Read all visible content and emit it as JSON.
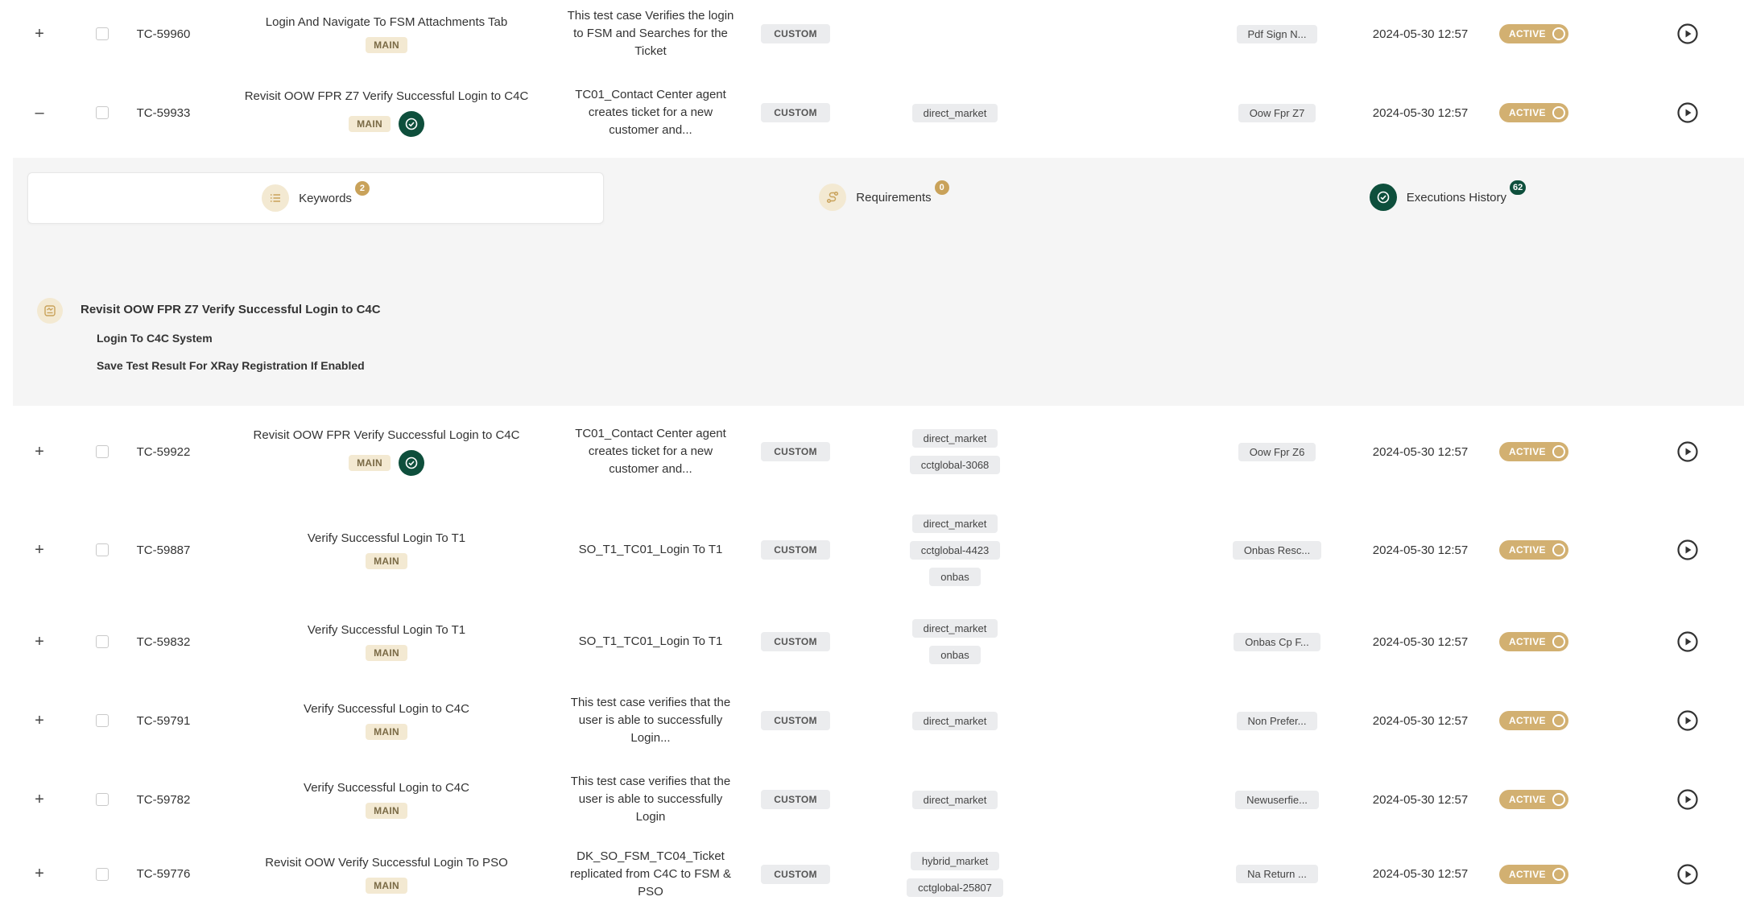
{
  "rows_top": [
    {
      "id": "TC-59960",
      "expander": "+",
      "name": "Login And Navigate To FSM Attachments Tab",
      "branch": "MAIN",
      "verified": false,
      "description": "This test case Verifies the login to FSM and Searches for the Ticket",
      "type": "CUSTOM",
      "tags": [],
      "folder": "Pdf Sign N...",
      "date": "2024-05-30 12:57",
      "status": "ACTIVE"
    },
    {
      "id": "TC-59933",
      "expander": "–",
      "name": "Revisit OOW FPR Z7 Verify Successful Login to C4C",
      "branch": "MAIN",
      "verified": true,
      "description": "TC01_Contact Center agent creates ticket for a new customer and...",
      "type": "CUSTOM",
      "tags": [
        "direct_market"
      ],
      "folder": "Oow Fpr Z7",
      "date": "2024-05-30 12:57",
      "status": "ACTIVE"
    }
  ],
  "detail": {
    "tabs": [
      {
        "label": "Keywords",
        "count": "2",
        "icon": "list-icon"
      },
      {
        "label": "Requirements",
        "count": "0",
        "icon": "route-icon"
      },
      {
        "label": "Executions History",
        "count": "62",
        "icon": "check-circle-icon"
      }
    ],
    "keyword_title": "Revisit OOW FPR Z7 Verify Successful Login to C4C",
    "keyword_steps": [
      "Login To C4C System",
      "Save Test Result For XRay Registration If Enabled"
    ]
  },
  "rows_bottom": [
    {
      "id": "TC-59922",
      "expander": "+",
      "name": "Revisit OOW FPR Verify Successful Login to C4C",
      "branch": "MAIN",
      "verified": true,
      "description": "TC01_Contact Center agent creates ticket for a new customer and...",
      "type": "CUSTOM",
      "tags": [
        "direct_market",
        "cctglobal-3068"
      ],
      "folder": "Oow Fpr Z6",
      "date": "2024-05-30 12:57",
      "status": "ACTIVE"
    },
    {
      "id": "TC-59887",
      "expander": "+",
      "name": "Verify Successful Login To T1",
      "branch": "MAIN",
      "verified": false,
      "description": "SO_T1_TC01_Login To T1",
      "type": "CUSTOM",
      "tags": [
        "direct_market",
        "cctglobal-4423",
        "onbas"
      ],
      "folder": "Onbas Resc...",
      "date": "2024-05-30 12:57",
      "status": "ACTIVE"
    },
    {
      "id": "TC-59832",
      "expander": "+",
      "name": "Verify Successful Login To T1",
      "branch": "MAIN",
      "verified": false,
      "description": "SO_T1_TC01_Login To T1",
      "type": "CUSTOM",
      "tags": [
        "direct_market",
        "onbas"
      ],
      "folder": "Onbas Cp F...",
      "date": "2024-05-30 12:57",
      "status": "ACTIVE"
    },
    {
      "id": "TC-59791",
      "expander": "+",
      "name": "Verify Successful Login to C4C",
      "branch": "MAIN",
      "verified": false,
      "description": "This test case verifies that the user is able to successfully Login...",
      "type": "CUSTOM",
      "tags": [
        "direct_market"
      ],
      "folder": "Non Prefer...",
      "date": "2024-05-30 12:57",
      "status": "ACTIVE"
    },
    {
      "id": "TC-59782",
      "expander": "+",
      "name": "Verify Successful Login to C4C",
      "branch": "MAIN",
      "verified": false,
      "description": "This test case verifies that the user is able to successfully Login",
      "type": "CUSTOM",
      "tags": [
        "direct_market"
      ],
      "folder": "Newuserfie...",
      "date": "2024-05-30 12:57",
      "status": "ACTIVE"
    },
    {
      "id": "TC-59776",
      "expander": "+",
      "name": "Revisit OOW Verify Successful Login To PSO",
      "branch": "MAIN",
      "verified": false,
      "description": "DK_SO_FSM_TC04_Ticket replicated from C4C to FSM & PSO",
      "type": "CUSTOM",
      "tags": [
        "hybrid_market",
        "cctglobal-25807"
      ],
      "folder": "Na Return ...",
      "date": "2024-05-30 12:57",
      "status": "ACTIVE"
    }
  ],
  "colors": {
    "accent": "#d2b071",
    "badge_bg": "#f3e9d2",
    "verified": "#0e4f3c",
    "tag_bg": "#ebecee"
  }
}
